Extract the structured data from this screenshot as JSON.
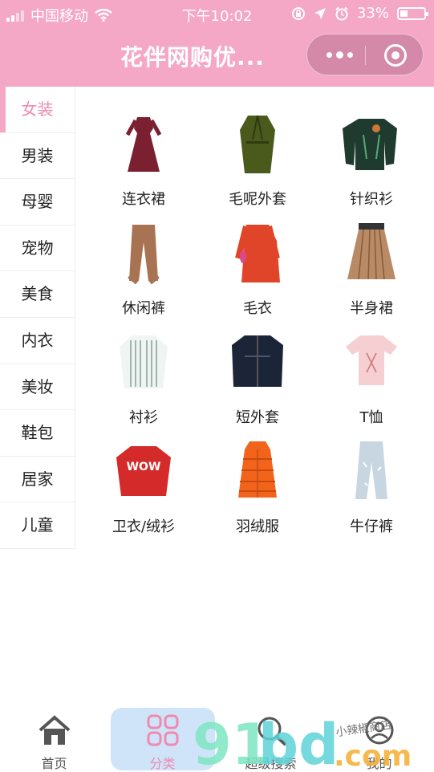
{
  "status_bar": {
    "carrier": "中国移动",
    "time": "下午10:02",
    "battery": "33%",
    "battery_level": 0.33
  },
  "header": {
    "title": "花伴网购优..."
  },
  "sidebar": {
    "items": [
      {
        "label": "女装",
        "active": true
      },
      {
        "label": "男装"
      },
      {
        "label": "母婴"
      },
      {
        "label": "宠物"
      },
      {
        "label": "美食"
      },
      {
        "label": "内衣"
      },
      {
        "label": "美妆"
      },
      {
        "label": "鞋包"
      },
      {
        "label": "居家"
      },
      {
        "label": "儿童"
      }
    ]
  },
  "categories": [
    {
      "label": "连衣裙",
      "icon": "dress-icon",
      "color": "#7a2030"
    },
    {
      "label": "毛呢外套",
      "icon": "wool-coat-icon",
      "color": "#4a5a1c"
    },
    {
      "label": "针织衫",
      "icon": "knit-sweater-icon",
      "color": "#1f3a2e"
    },
    {
      "label": "休闲裤",
      "icon": "casual-pants-icon",
      "color": "#a87352"
    },
    {
      "label": "毛衣",
      "icon": "sweater-icon",
      "color": "#e0452a"
    },
    {
      "label": "半身裙",
      "icon": "skirt-icon",
      "color": "#b88a66"
    },
    {
      "label": "衬衫",
      "icon": "shirt-icon",
      "color": "#8aa59a"
    },
    {
      "label": "短外套",
      "icon": "jacket-icon",
      "color": "#1c2438"
    },
    {
      "label": "T恤",
      "icon": "tshirt-icon",
      "color": "#f5cfd2"
    },
    {
      "label": "卫衣/绒衫",
      "icon": "hoodie-icon",
      "color": "#d42a2a"
    },
    {
      "label": "羽绒服",
      "icon": "down-coat-icon",
      "color": "#f2641c"
    },
    {
      "label": "牛仔裤",
      "icon": "jeans-icon",
      "color": "#c8d6e2"
    }
  ],
  "tabbar": {
    "items": [
      {
        "label": "首页",
        "icon": "home-icon"
      },
      {
        "label": "分类",
        "icon": "grid-icon",
        "active": true
      },
      {
        "label": "超级搜索",
        "icon": "search-icon"
      },
      {
        "label": "我的",
        "icon": "user-icon"
      }
    ]
  },
  "watermark": {
    "text": "91bd.com",
    "subtext": "小辣椒商店"
  },
  "colors": {
    "brand_pink": "#f4a8c6",
    "active_text": "#f08ab1"
  }
}
